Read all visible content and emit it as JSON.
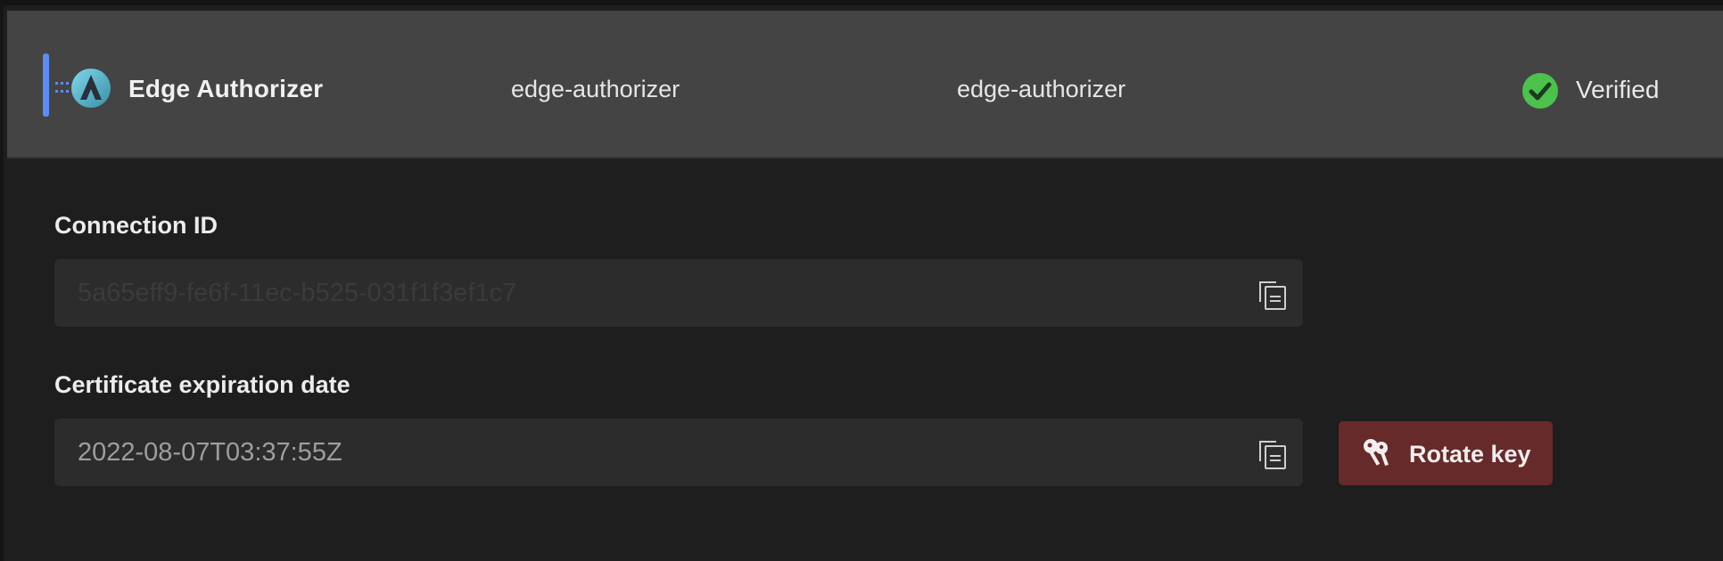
{
  "header": {
    "app_name": "Edge Authorizer",
    "column1": "edge-authorizer",
    "column2": "edge-authorizer",
    "status": "Verified",
    "accent_color": "#5b8ef5",
    "status_color": "#4cc24c",
    "icons": {
      "logo": "edge-authorizer-logo-icon",
      "status": "check-circle-icon"
    }
  },
  "connection_id": {
    "label": "Connection ID",
    "value": "5a65eff9-fe6f-11ec-b525-031f1f3ef1c7",
    "copy_icon": "copy-icon"
  },
  "certificate": {
    "label": "Certificate expiration date",
    "value": "2022-08-07T03:37:55Z",
    "copy_icon": "copy-icon"
  },
  "rotate_button": {
    "label": "Rotate key",
    "icon": "keys-icon",
    "color": "#662a2a"
  }
}
